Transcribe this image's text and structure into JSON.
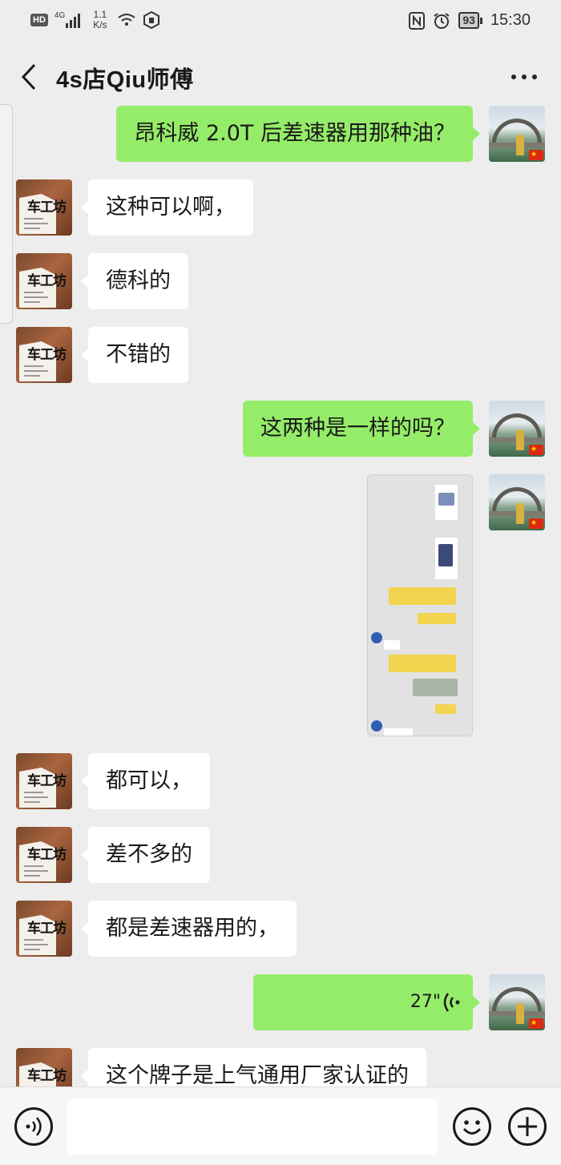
{
  "status_bar": {
    "hd": "HD",
    "network": "4G",
    "speed_top": "1.1",
    "speed_bottom": "K/s",
    "battery": "93",
    "time": "15:30",
    "icons": [
      "hd-icon",
      "signal-icon",
      "wifi-icon",
      "hotspot-icon",
      "nfc-icon",
      "alarm-icon",
      "battery-icon"
    ]
  },
  "header": {
    "title": "4s店Qiu师傅",
    "icons": [
      "back-icon",
      "more-icon"
    ]
  },
  "messages": [
    {
      "side": "out",
      "text": "昂科威 2.0T 后差速器用那种油？"
    },
    {
      "side": "in",
      "text": "这种可以啊，"
    },
    {
      "side": "in",
      "text": "德科的"
    },
    {
      "side": "in",
      "text": "不错的"
    },
    {
      "side": "out",
      "text": "这两种是一样的吗？"
    },
    {
      "side": "out",
      "type": "image"
    },
    {
      "side": "in",
      "text": "都可以，"
    },
    {
      "side": "in",
      "text": "差不多的"
    },
    {
      "side": "in",
      "text": "都是差速器用的，"
    },
    {
      "side": "out",
      "type": "voice",
      "duration": "27\""
    },
    {
      "side": "in",
      "text": "这个牌子是上气通用厂家认证的"
    }
  ],
  "avatar_shop": {
    "brand_text": "车工坊"
  },
  "input_bar": {
    "placeholder": "",
    "icons": [
      "voice-icon",
      "emoji-icon",
      "plus-icon"
    ]
  }
}
